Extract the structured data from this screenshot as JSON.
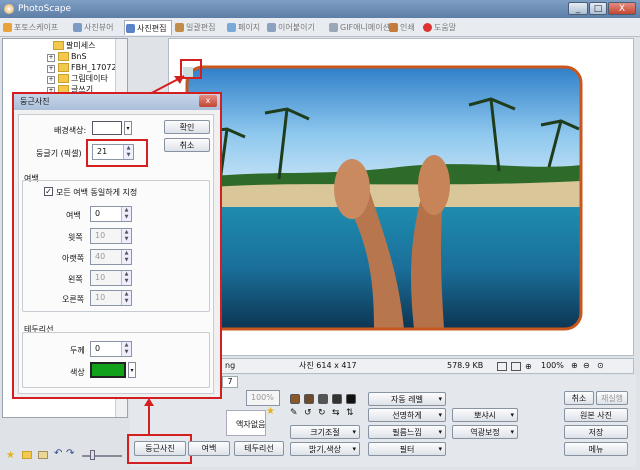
{
  "window": {
    "title": "PhotoScape",
    "minimize": "_",
    "maximize": "□",
    "close": "X"
  },
  "tabs": [
    {
      "label": "포토스케이프"
    },
    {
      "label": "사진뷰어"
    },
    {
      "label": "사진편집"
    },
    {
      "label": "일괄편집"
    },
    {
      "label": "페이지"
    },
    {
      "label": "이어붙이기"
    },
    {
      "label": "GIF애니메이션"
    },
    {
      "label": "인쇄"
    },
    {
      "label": "도움말"
    }
  ],
  "tree": {
    "items": [
      "팔미세스",
      "BnS",
      "FBH_17072",
      "그림데이타",
      "글쓰기"
    ]
  },
  "status": {
    "left_text": "ng",
    "image_size": "사진 614 x 417",
    "file_size": "578.9 KB",
    "zoom": "100%"
  },
  "panel": {
    "tab": "7",
    "zoom_value": "100%",
    "frame_name": "액자없음"
  },
  "bottom_buttons": {
    "round": "둥근사진",
    "margin": "여백",
    "border": "테두리선"
  },
  "edit_buttons": {
    "auto_level": "자동 레벨",
    "sharpen": "선명하게",
    "backlight": "뽀샤시",
    "resize": "크기조절",
    "film_effect": "필름느낌",
    "backlight_correct": "역광보정",
    "bright_color": "밝기,색상",
    "filter": "필터"
  },
  "right_buttons": {
    "cancel": "취소",
    "redo": "재실행",
    "original": "원본 사진",
    "save": "저장",
    "menu": "메뉴"
  },
  "dialog": {
    "title": "둥근사진",
    "close": "x",
    "bg_color_label": "배경색상:",
    "radius_label": "둥글기 (픽셀)",
    "radius_value": "21",
    "ok": "확인",
    "cancel": "취소",
    "margin_group": "여백",
    "same_all_label": "모든 여백 동일하게 지정",
    "margin_label": "여백",
    "margin_value": "0",
    "top_label": "윗쪽",
    "top_value": "10",
    "bottom_label": "아랫쪽",
    "bottom_value": "40",
    "left_label": "왼쪽",
    "left_value": "10",
    "right_label": "오른쪽",
    "right_value": "10",
    "border_group": "테두리선",
    "thickness_label": "두께",
    "thickness_value": "0",
    "color_label": "색상"
  },
  "colors": {
    "accent_red": "#d31f1f",
    "border_color": "#11a11a",
    "photo_border": "#c9571d"
  }
}
